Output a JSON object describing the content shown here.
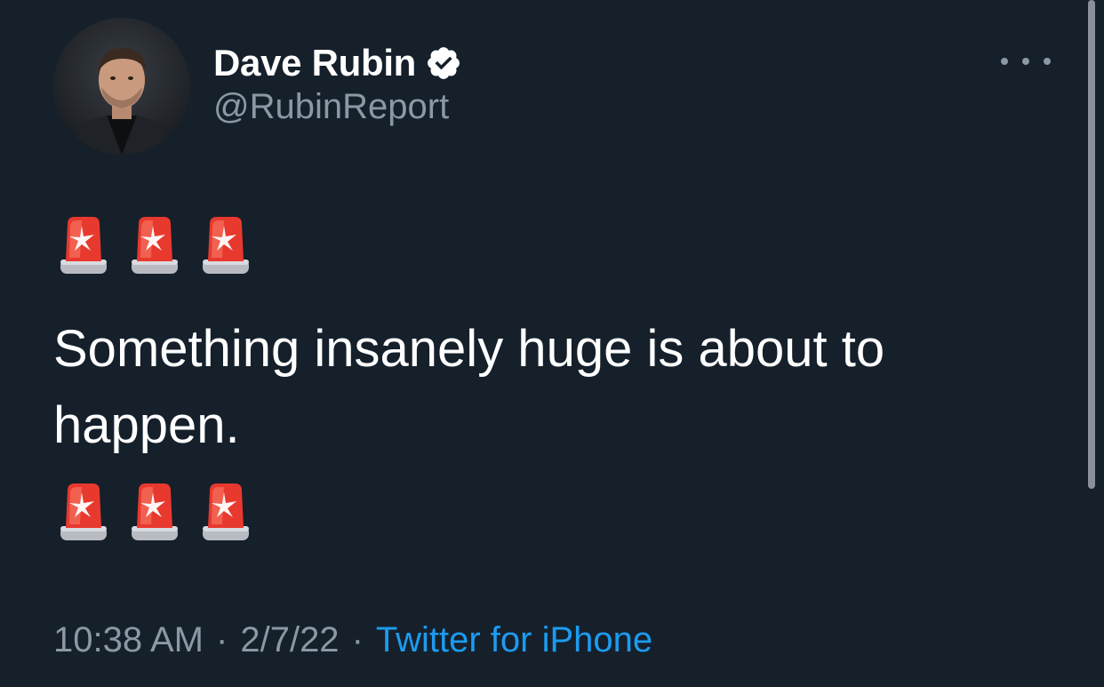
{
  "tweet": {
    "author": {
      "display_name": "Dave Rubin",
      "handle": "@RubinReport",
      "verified": true
    },
    "more_icon": "more-horizontal-icon",
    "emoji_line_top": [
      "🚨",
      "🚨",
      "🚨"
    ],
    "text": "Something insanely huge is about to happen.",
    "emoji_line_bottom": [
      "🚨",
      "🚨",
      "🚨"
    ],
    "time": "10:38 AM",
    "date": "2/7/22",
    "separator": "·",
    "source": "Twitter for iPhone"
  },
  "colors": {
    "background": "#15202b",
    "primary_text": "#ffffff",
    "secondary_text": "#8b98a5",
    "link": "#1d9bf0"
  }
}
